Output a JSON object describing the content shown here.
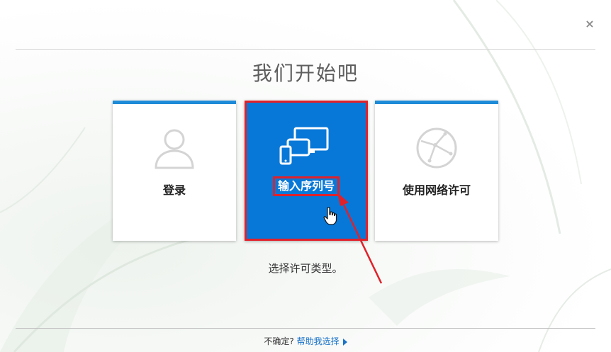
{
  "window": {
    "close_glyph": "×"
  },
  "header": {
    "title": "我们开始吧"
  },
  "cards": [
    {
      "label": "登录",
      "icon": "user-icon"
    },
    {
      "label": "输入序列号",
      "icon": "devices-icon",
      "selected": true
    },
    {
      "label": "使用网络许可",
      "icon": "globe-network-icon"
    }
  ],
  "hint": "选择许可类型。",
  "footer": {
    "question": "不确定?",
    "help_link": "帮助我选择"
  },
  "colors": {
    "accent_blue": "#1e8bd8",
    "selected_blue": "#0878d8",
    "highlight_red": "#e0212a",
    "link_blue": "#1a73c9"
  }
}
